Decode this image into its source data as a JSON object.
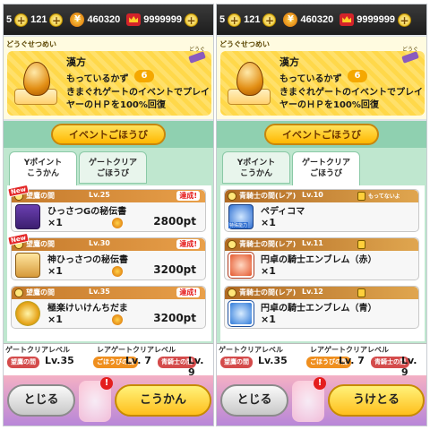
{
  "currency": {
    "stamina_value": "5",
    "coins_value": "121",
    "ymoney_value": "460320",
    "points_value": "9999999"
  },
  "left": {
    "description": {
      "caption": "どうぐせつめい",
      "dougu_label": "どうぐ",
      "item_name": "漢方",
      "count_label": "もっているかず",
      "count": "6",
      "text": "きまぐれゲートのイベントでプレイヤーのＨＰを100%回復"
    },
    "banner": "イベントごほうび",
    "tabs": [
      {
        "label": "Yポイント\nこうかん",
        "active": true
      },
      {
        "label": "ゲートクリア\nごほうび",
        "active": false
      }
    ],
    "rows": [
      {
        "gate": "望鷹の間",
        "level": "Lv.25",
        "tag": "達成!",
        "new": "New",
        "name": "ひっさつGの秘伝書",
        "qty": "×1",
        "cost": "2800pt"
      },
      {
        "gate": "望鷹の間",
        "level": "Lv.30",
        "tag": "達成!",
        "new": "New",
        "name": "神ひっさつの秘伝書",
        "qty": "×1",
        "cost": "3200pt"
      },
      {
        "gate": "望鷹の間",
        "level": "Lv.35",
        "tag": "達成!",
        "new": "",
        "name": "極楽けいけんちだま",
        "qty": "×1",
        "cost": "3200pt"
      }
    ],
    "levels": {
      "label1": "ゲートクリアレベル",
      "label2": "レアゲートクリアレベル",
      "badge1": "望鷹の間",
      "val1": "Lv.35",
      "badge2": "ごほうびの間",
      "val2": "Lv. 7",
      "badge3": "青騎士の間",
      "val3": "Lv. 9"
    },
    "close_label": "とじる",
    "main_label": "こうかん"
  },
  "right": {
    "description": {
      "caption": "どうぐせつめい",
      "dougu_label": "どうぐ",
      "item_name": "漢方",
      "count_label": "もっているかず",
      "count": "6",
      "text": "きまぐれゲートのイベントでプレイヤーのＨＰを100%回復"
    },
    "banner": "イベントごほうび",
    "tabs": [
      {
        "label": "Yポイント\nこうかん",
        "active": false
      },
      {
        "label": "ゲートクリア\nごほうび",
        "active": true
      }
    ],
    "rows": [
      {
        "gate": "青騎士の間(レア)",
        "level": "Lv.10",
        "lockmsg": "もってないよ",
        "special": "特殊能力",
        "name": "ペディコマ",
        "qty": "×1"
      },
      {
        "gate": "青騎士の間(レア)",
        "level": "Lv.11",
        "lockmsg": "",
        "special": "",
        "name": "円卓の騎士エンブレム（赤）",
        "qty": "×1"
      },
      {
        "gate": "青騎士の間(レア)",
        "level": "Lv.12",
        "lockmsg": "",
        "special": "",
        "name": "円卓の騎士エンブレム（青）",
        "qty": "×1"
      }
    ],
    "levels": {
      "label1": "ゲートクリアレベル",
      "label2": "レアゲートクリアレベル",
      "badge1": "望鷹の間",
      "val1": "Lv.35",
      "badge2": "ごほうびの間",
      "val2": "Lv. 7",
      "badge3": "青騎士の間",
      "val3": "Lv. 9"
    },
    "close_label": "とじる",
    "main_label": "うけとる"
  },
  "colors": {
    "accent_yellow": "#ffbf1c",
    "row_header": "#c47a2c",
    "list_bg": "#bfe7cf"
  }
}
